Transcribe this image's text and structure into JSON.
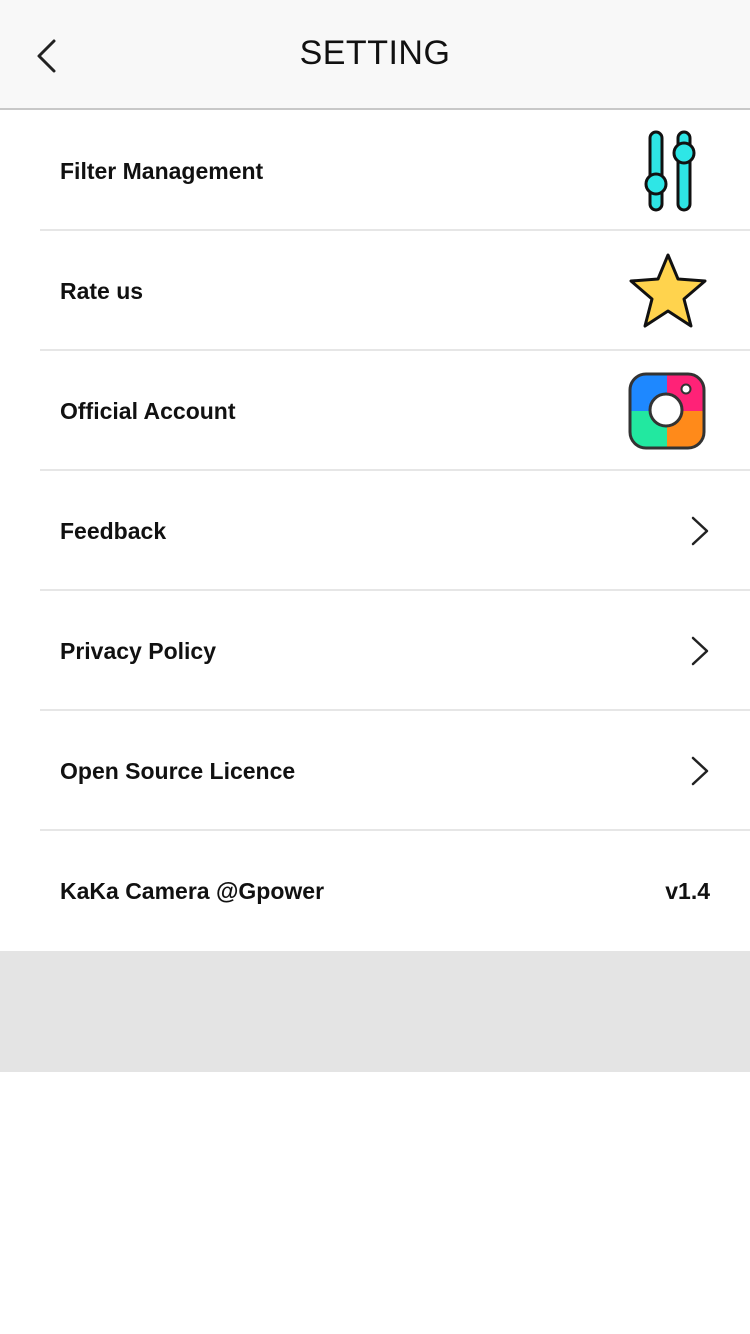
{
  "header": {
    "title": "SETTING",
    "back_icon": "chevron-left-icon"
  },
  "settings": {
    "items": [
      {
        "label": "Filter Management",
        "icon": "sliders-icon",
        "icon_color": "#2ee6e6"
      },
      {
        "label": "Rate us",
        "icon": "star-icon",
        "icon_color": "#ffd34d"
      },
      {
        "label": "Official Account",
        "icon": "instagram-icon",
        "icon_colors": [
          "#1e88ff",
          "#ff2277",
          "#22e8a0",
          "#ff8a1a"
        ]
      },
      {
        "label": "Feedback",
        "icon": "chevron-right-icon"
      },
      {
        "label": "Privacy Policy",
        "icon": "chevron-right-icon"
      },
      {
        "label": "Open Source Licence",
        "icon": "chevron-right-icon"
      },
      {
        "label": "KaKa Camera @Gpower",
        "version": "v1.4"
      }
    ]
  },
  "colors": {
    "navbar_bg": "#f8f8f8",
    "status_dot": "#4cd964",
    "footer_band": "#e4e4e4"
  }
}
